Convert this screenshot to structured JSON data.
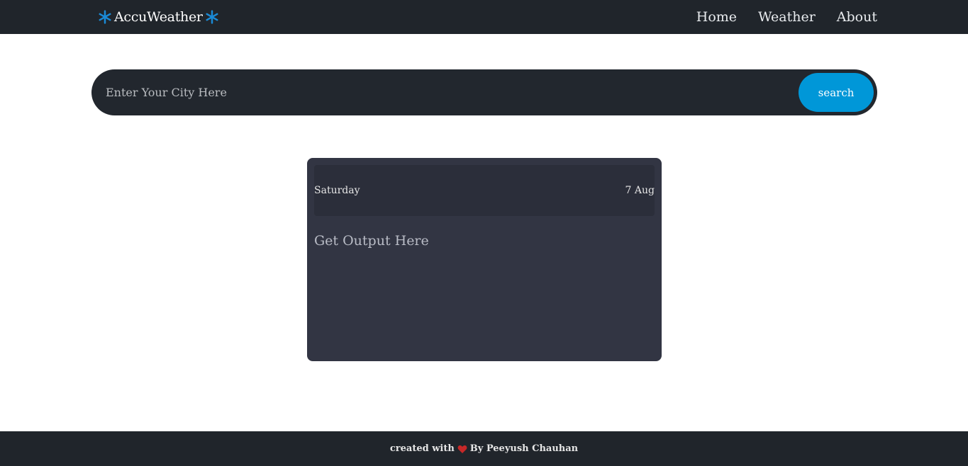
{
  "navbar": {
    "brand": "AccuWeather",
    "brand_icon": "snowflake-icon",
    "brand_icon_color": "#1a8ad6",
    "links": [
      "Home",
      "Weather",
      "About"
    ]
  },
  "search": {
    "placeholder": "Enter Your City Here",
    "value": "",
    "button_label": "search",
    "button_color": "#0097d8"
  },
  "card": {
    "day": "Saturday",
    "date": "7 Aug",
    "output_text": "Get Output Here"
  },
  "footer": {
    "text_before": "created with",
    "heart_icon": "heart-icon",
    "heart_color": "#c62828",
    "text_after": "By Peeyush Chauhan"
  }
}
